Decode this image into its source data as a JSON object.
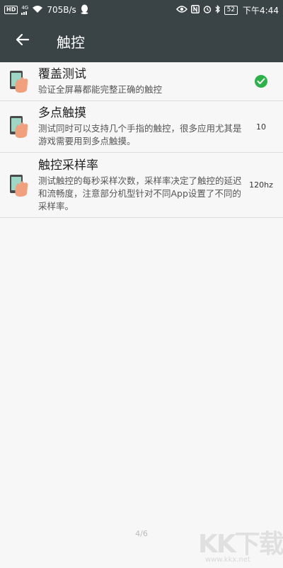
{
  "status_bar": {
    "hd": "HD",
    "net_type": "4G",
    "speed": "705B/s",
    "battery": "52",
    "time": "下午4:44"
  },
  "app_bar": {
    "back_icon": "arrow-left-icon",
    "title": "触控"
  },
  "items": [
    {
      "title": "覆盖测试",
      "desc": "验证全屏幕都能完整正确的触控",
      "value": "",
      "status_icon": "check-circle-icon"
    },
    {
      "title": "多点触摸",
      "desc": "测试同时可以支持几个手指的触控，很多应用尤其是游戏需要用到多点触摸。",
      "value": "10"
    },
    {
      "title": "触控采样率",
      "desc": "测试触控的每秒采样次数，采样率决定了触控的延迟和流畅度，注意部分机型针对不同App设置了不同的采样率。",
      "value": "120hz"
    }
  ],
  "pager": "4/6",
  "watermark": {
    "main": "KK下载",
    "sub": "www.kkx.net"
  },
  "colors": {
    "app_bar": "#3a4447",
    "check": "#2db24a",
    "background": "#f7f7f7"
  }
}
